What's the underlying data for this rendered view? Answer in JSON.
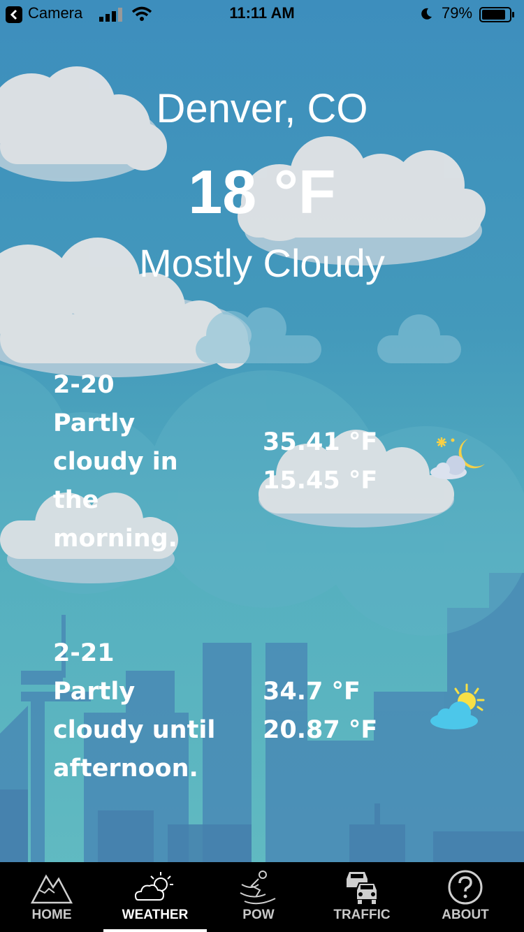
{
  "status_bar": {
    "back_label": "Camera",
    "time": "11:11 AM",
    "battery": "79%"
  },
  "header": {
    "city": "Denver, CO",
    "temperature": "18 °F",
    "condition": "Mostly Cloudy"
  },
  "forecast": [
    {
      "date": "2-20",
      "summary": "Partly cloudy in the morning.",
      "high": "35.41 °F",
      "low": "15.45 °F",
      "icon": "partly-cloudy-night-icon"
    },
    {
      "date": "2-21",
      "summary": "Partly cloudy until afternoon.",
      "high": "34.7 °F",
      "low": "20.87 °F",
      "icon": "partly-cloudy-day-icon"
    }
  ],
  "tabs": [
    {
      "label": "HOME",
      "icon": "mountain-icon"
    },
    {
      "label": "WEATHER",
      "icon": "weather-icon"
    },
    {
      "label": "POW",
      "icon": "skier-icon"
    },
    {
      "label": "TRAFFIC",
      "icon": "cars-icon"
    },
    {
      "label": "ABOUT",
      "icon": "question-icon"
    }
  ],
  "active_tab": "WEATHER"
}
